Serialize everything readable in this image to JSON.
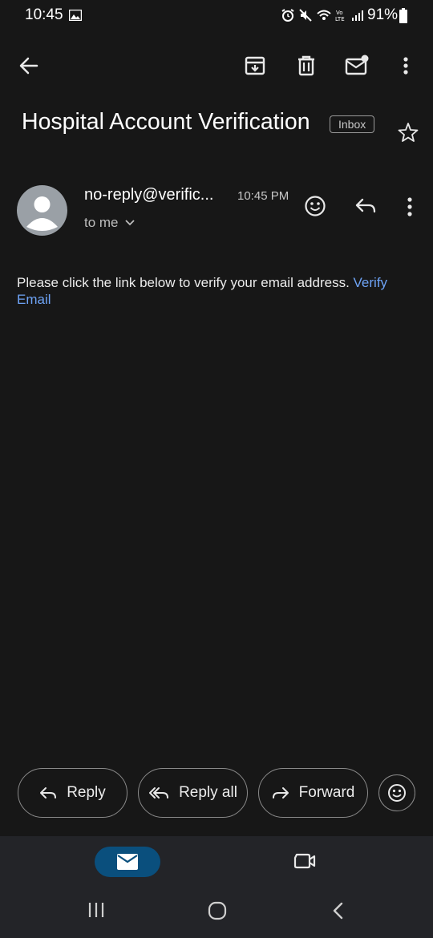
{
  "status_bar": {
    "time": "10:45",
    "battery": "91%"
  },
  "toolbar": {
    "icons": [
      "back-arrow-icon",
      "archive-icon",
      "delete-icon",
      "mark-unread-icon",
      "more-vert-icon"
    ]
  },
  "email": {
    "subject": "Hospital Account Verification",
    "label": "Inbox",
    "sender": "no-reply@verific...",
    "time": "10:45 PM",
    "recipient": "to me",
    "body_text": "Please click the link below to verify your email address.",
    "link_text": "Verify Email"
  },
  "actions": {
    "reply": "Reply",
    "reply_all": "Reply all",
    "forward": "Forward"
  },
  "colors": {
    "background": "#171717",
    "link": "#6ea3f5",
    "nav_active": "#0a4f7d"
  }
}
